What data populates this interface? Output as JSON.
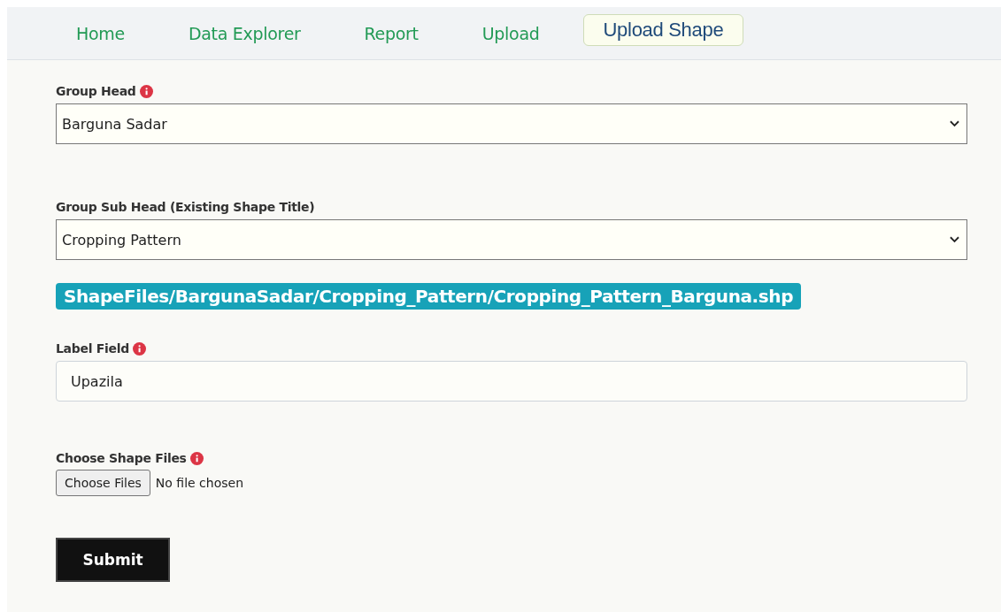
{
  "nav": {
    "tabs": [
      {
        "label": "Home",
        "selected": false
      },
      {
        "label": "Data Explorer",
        "selected": false
      },
      {
        "label": "Report",
        "selected": false
      },
      {
        "label": "Upload",
        "selected": false
      },
      {
        "label": "Upload Shape",
        "selected": true
      }
    ]
  },
  "form": {
    "group_head": {
      "label": "Group Head",
      "value": "Barguna Sadar"
    },
    "group_sub_head": {
      "label": "Group Sub Head (Existing Shape Title)",
      "value": "Cropping Pattern"
    },
    "shape_path": "ShapeFiles/BargunaSadar/Cropping_Pattern/Cropping_Pattern_Barguna.shp",
    "label_field": {
      "label": "Label Field",
      "value": "Upazila"
    },
    "shape_files": {
      "label": "Choose Shape Files",
      "button": "Choose Files",
      "status": "No file chosen"
    },
    "submit": "Submit"
  }
}
